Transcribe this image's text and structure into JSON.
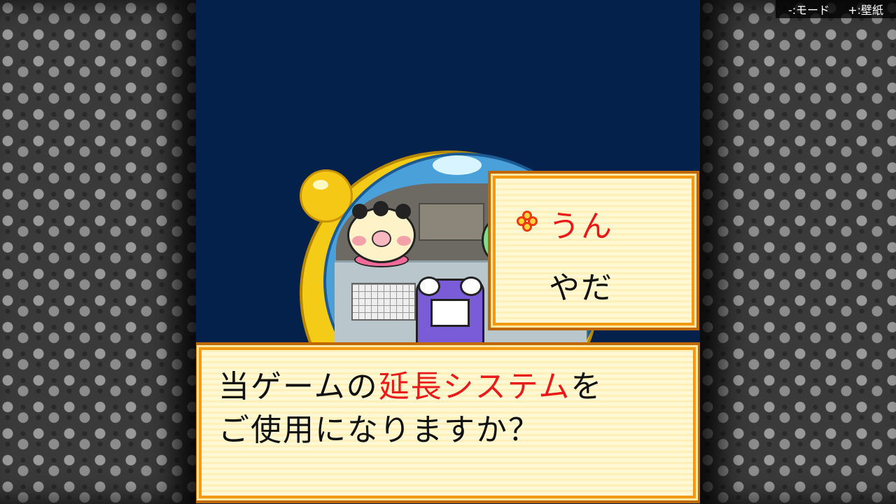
{
  "hints": {
    "mode": "-:モード",
    "wallpaper": "+:壁紙"
  },
  "choices": [
    {
      "label": "うん",
      "selected": true
    },
    {
      "label": "やだ",
      "selected": false
    }
  ],
  "message": {
    "line1_pre": "当ゲームの",
    "line1_highlight": "延長システム",
    "line1_post": "を",
    "line2": "ご使用になりますか？"
  },
  "colors": {
    "highlight": "#e81a1a",
    "box_border": "#f29a14",
    "screen_bg": "#03214a"
  }
}
